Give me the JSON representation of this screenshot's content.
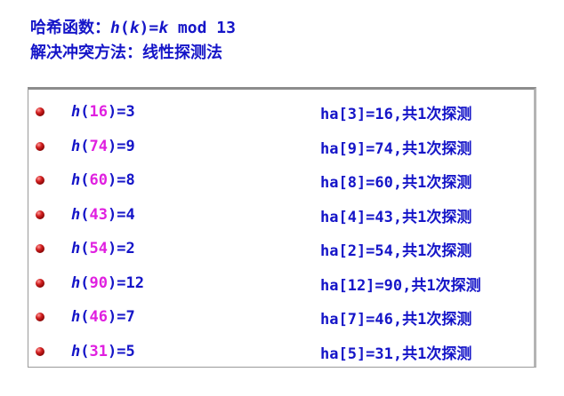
{
  "header": {
    "line1_prefix": "哈希函数：",
    "line1_fn": "h",
    "line1_open": "(",
    "line1_k": "k",
    "line1_close": ")=",
    "line1_k2": "k",
    "line1_rest": " mod 13",
    "line2": "解决冲突方法：线性探测法"
  },
  "colors": {
    "text": "#1515c8",
    "key": "#e020e0",
    "bullet": "#c01010"
  },
  "rows": [
    {
      "fn": "h",
      "open": "(",
      "key": "16",
      "close": ")=",
      "value": "3",
      "result": "ha[3]=16,共1次探测"
    },
    {
      "fn": "h",
      "open": "(",
      "key": "74",
      "close": ")=",
      "value": "9",
      "result": "ha[9]=74,共1次探测"
    },
    {
      "fn": "h",
      "open": "(",
      "key": "60",
      "close": ")=",
      "value": "8",
      "result": "ha[8]=60,共1次探测"
    },
    {
      "fn": "h",
      "open": "(",
      "key": "43",
      "close": ")=",
      "value": "4",
      "result": "ha[4]=43,共1次探测"
    },
    {
      "fn": "h",
      "open": "(",
      "key": "54",
      "close": ")=",
      "value": "2",
      "result": "ha[2]=54,共1次探测"
    },
    {
      "fn": "h",
      "open": "(",
      "key": "90",
      "close": ")=",
      "value": "12",
      "result": "ha[12]=90,共1次探测"
    },
    {
      "fn": "h",
      "open": "(",
      "key": "46",
      "close": ")=",
      "value": "7",
      "result": "ha[7]=46,共1次探测"
    },
    {
      "fn": "h",
      "open": "(",
      "key": "31",
      "close": ")=",
      "value": "5",
      "result": "ha[5]=31,共1次探测"
    }
  ]
}
